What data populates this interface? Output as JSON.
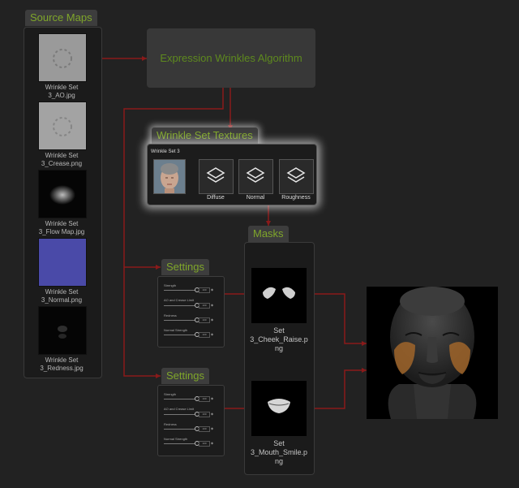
{
  "source_maps": {
    "title": "Source Maps",
    "items": [
      {
        "label_line1": "Wrinkle Set",
        "label_line2": "3_AO.jpg"
      },
      {
        "label_line1": "Wrinkle Set",
        "label_line2": "3_Crease.png"
      },
      {
        "label_line1": "Wrinkle Set",
        "label_line2": "3_Flow Map.jpg"
      },
      {
        "label_line1": "Wrinkle Set",
        "label_line2": "3_Normal.png"
      },
      {
        "label_line1": "Wrinkle Set",
        "label_line2": "3_Redness.jpg"
      }
    ]
  },
  "algorithm": {
    "label": "Expression Wrinkles Algorithm"
  },
  "wrinkle_set_textures": {
    "title": "Wrinkle Set Textures",
    "set_name": "Wrinkle Set 3",
    "textures": [
      "Diffuse",
      "Normal",
      "Roughness"
    ]
  },
  "masks": {
    "title": "Masks",
    "items": [
      {
        "line1": "Set",
        "line2": "3_Cheek_Raise.p",
        "line3": "ng"
      },
      {
        "line1": "Set",
        "line2": "3_Mouth_Smile.p",
        "line3": "ng"
      }
    ]
  },
  "settings": [
    {
      "title": "Settings",
      "rows": [
        {
          "label": "Strength",
          "value": "100"
        },
        {
          "label": "AO and Crease Limit",
          "value": "100"
        },
        {
          "label": "Redness",
          "value": "100"
        },
        {
          "label": "Normal Strength",
          "value": "100"
        }
      ]
    },
    {
      "title": "Settings",
      "rows": [
        {
          "label": "Strength",
          "value": "100"
        },
        {
          "label": "AO and Crease Limit",
          "value": "100"
        },
        {
          "label": "Redness",
          "value": "100"
        },
        {
          "label": "Normal Strength",
          "value": "100"
        }
      ]
    }
  ],
  "colors": {
    "connector": "#8a1a1a",
    "title_text": "#7fa62a",
    "highlight": "#c4712a"
  }
}
